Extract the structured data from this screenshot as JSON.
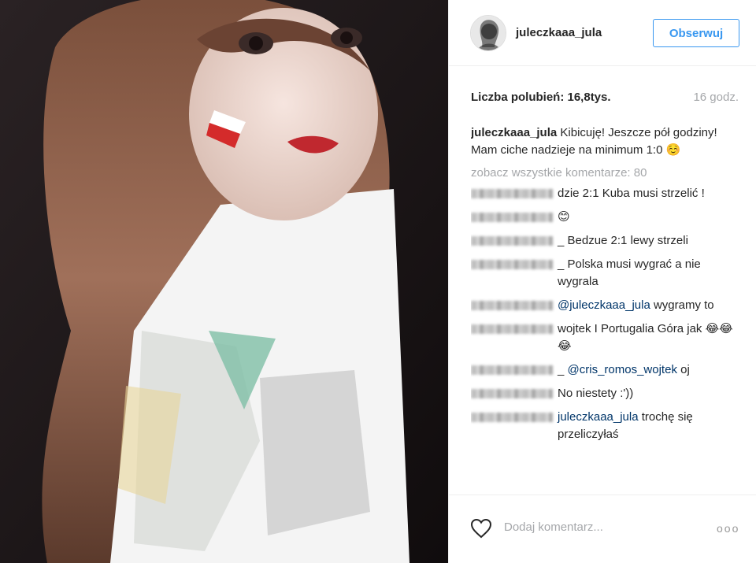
{
  "header": {
    "username": "juleczkaaa_jula",
    "follow_label": "Obserwuj"
  },
  "post": {
    "likes": "Liczba polubień: 16,8tys.",
    "time": "16 godz.",
    "caption_user": "juleczkaaa_jula",
    "caption_text": " Kibicuję! Jeszcze pół godziny! Mam ciche nadzieje na minimum 1:0 ☺️",
    "view_all": "zobacz wszystkie komentarze: 80"
  },
  "comments": [
    {
      "text": "dzie 2:1 Kuba musi strzelić !"
    },
    {
      "text": "😊"
    },
    {
      "text": "_ Bedzue 2:1 lewy strzeli"
    },
    {
      "text": "_ Polska musi wygrać a nie wygrala"
    },
    {
      "mention": "@juleczkaaa_jula",
      "text": " wygramy to"
    },
    {
      "text": "wojtek I Portugalia Góra jak 😂😂😂"
    },
    {
      "mention": "@cris_romos_wojtek",
      "text": " oj",
      "prefix": "_ "
    },
    {
      "text": "No niestety :'))"
    },
    {
      "mention": "juleczkaaa_jula",
      "text": " trochę się przeliczyłaś",
      "prefix": ""
    }
  ],
  "footer": {
    "add_comment_placeholder": "Dodaj komentarz...",
    "more_label": "ooo"
  },
  "icons": {
    "heart": "heart-icon",
    "more": "more-options-icon"
  }
}
